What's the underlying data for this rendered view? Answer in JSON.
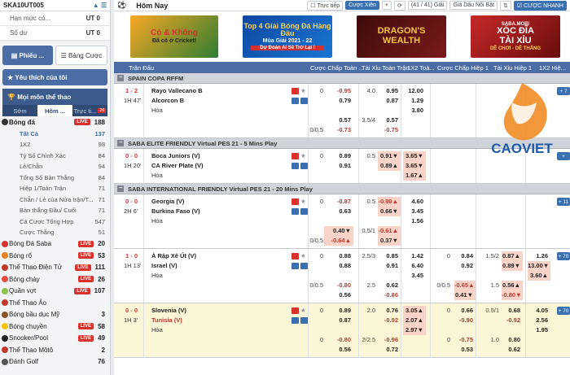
{
  "account": {
    "username": "SKA10UT005",
    "arrows": "▲ ☰",
    "rows": [
      {
        "label": "Hạn mức có...",
        "value": "UT 0"
      },
      {
        "label": "Số dư",
        "value": "UT 0"
      }
    ]
  },
  "ticket_tabs": [
    {
      "label": "Phiếu ...",
      "icon": "ticket-icon"
    },
    {
      "label": "Bảng Cược",
      "icon": "list-icon"
    }
  ],
  "favorites": "Yêu thích của tôi",
  "all_sports": "Mọi môn thể thao",
  "sub_tabs": [
    "Sớm",
    "Hôm ...",
    "Trực ti..."
  ],
  "sub_tab_badge": "26",
  "sports": [
    {
      "name": "Bóng đá",
      "live": "LIVE",
      "count": "188",
      "color": "#333"
    },
    {
      "name": "Bóng Đá Saba",
      "live": "LIVE",
      "count": "20",
      "color": "#d9322c"
    },
    {
      "name": "Bóng rổ",
      "live": "LIVE",
      "count": "53",
      "color": "#e67e22"
    },
    {
      "name": "Thể Thao Điện Tử",
      "live": "LIVE",
      "count": "111",
      "color": "#c0392b"
    },
    {
      "name": "Bóng chày",
      "live": "LIVE",
      "count": "26",
      "color": "#e74c3c"
    },
    {
      "name": "Quần vợt",
      "live": "LIVE",
      "count": "107",
      "color": "#8bc34a"
    },
    {
      "name": "Thể Thao Ảo",
      "live": "",
      "count": "",
      "color": "#c0392b"
    },
    {
      "name": "Bóng bầu dục Mỹ",
      "live": "",
      "count": "3",
      "color": "#8d5524"
    },
    {
      "name": "Bóng chuyền",
      "live": "LIVE",
      "count": "58",
      "color": "#f1c40f"
    },
    {
      "name": "Snooker/Pool",
      "live": "LIVE",
      "count": "49",
      "color": "#222"
    },
    {
      "name": "Thể Thao Môtô",
      "live": "",
      "count": "2",
      "color": "#c0392b"
    },
    {
      "name": "Đánh Golf",
      "live": "",
      "count": "76",
      "color": "#555"
    }
  ],
  "football_sub": [
    {
      "name": "Tất Cả",
      "count": "137"
    },
    {
      "name": "1X2",
      "count": "98"
    },
    {
      "name": "Tỷ Số Chính Xác",
      "count": "84"
    },
    {
      "name": "Lẻ/Chẵn",
      "count": "94"
    },
    {
      "name": "Tổng Số Bàn Thắng",
      "count": "84"
    },
    {
      "name": "Hiệp 1/Toàn Trận",
      "count": "71"
    },
    {
      "name": "Chẵn / Lẻ của Nửa trận/T...",
      "count": "71"
    },
    {
      "name": "Bàn thắng Đầu/ Cuối",
      "count": "71"
    },
    {
      "name": "Cá Cược Tổng Hợp",
      "count": "547"
    },
    {
      "name": "Cược Thắng",
      "count": "51"
    }
  ],
  "topbar": {
    "title": "Hôm Nay",
    "live_chk": "Trực tiếp",
    "bet_btn": "Cược Xiên",
    "plus": "+",
    "page": "(41 / 41) Giải",
    "odds_sel": "Giá Dấu Nổi Bật",
    "fast": "CƯỢC NHANH"
  },
  "banners": [
    {
      "line1": "Cỏ & Không",
      "line2": "Đã có ở Cricket!",
      "bg": "#2e7d32"
    },
    {
      "line1": "Top 4 Giải Bóng Đá Hàng Đầu",
      "line2": "Mùa Giải 2021 - 22",
      "line3": "Dự Đoán Ai Sẽ Trở Lại !",
      "bg": "#0d47a1"
    },
    {
      "line1": "DRAGON'S",
      "line2": "WEALTH",
      "bg": "#4a0e0e"
    },
    {
      "line1": "SABA.MOBI",
      "line2": "XÓC ĐĨA",
      "line3": "TÀI XỈU",
      "line4": "DỄ CHƠI - DỄ THẮNG",
      "bg": "#b71c1c"
    }
  ],
  "headers": {
    "time": "Trận Đấu",
    "h1": "Cược Chấp Toàn ...",
    "h2": "Tài Xỉu Toàn Trận",
    "h3": "1X2 Toà...",
    "h4": "Cược Chấp Hiệp 1",
    "h5": "Tài Xỉu Hiệp 1",
    "h6": "1X2 Hiệ..."
  },
  "leagues": [
    {
      "name": "SPAIN COPA RFFM",
      "matches": [
        {
          "score": "1 - 2",
          "time": "1H 47'",
          "home": "Rayo Vallecano B",
          "away": "Alcorcon B",
          "draw": "Hòa",
          "rows": [
            {
              "hdp": "0",
              "hdp_h": "-0.95",
              "ou": "4.0",
              "ou_h": "0.95",
              "x1": "12.00"
            },
            {
              "hdp_a": "0.79",
              "ou_a": "0.87",
              "x2": "1.29"
            },
            {
              "x3": "3.80"
            },
            {
              "hdp_h": "0.57",
              "ou": "3.5/4",
              "ou_h": "0.57"
            },
            {
              "hdp": "0/0.5",
              "hdp_a": "-0.73",
              "ou_a": "-0.75"
            }
          ]
        }
      ]
    },
    {
      "name": "SABA ELITE FRIENDLY Virtual PES 21 - 5 Mins Play",
      "matches": [
        {
          "score": "0 - 0",
          "time": "1H 20'",
          "home": "Boca Juniors (V)",
          "away": "CA River Plate (V)",
          "draw": "Hòa",
          "rows": [
            {
              "hdp": "0",
              "hdp_h": "0.89",
              "ou": "0.5",
              "ou_h": "0.91▼",
              "x1": "3.65▼"
            },
            {
              "hdp_a": "0.91",
              "ou_a": "0.89▲",
              "x2": "3.65▼"
            },
            {
              "x3": "1.67▲"
            }
          ]
        }
      ]
    },
    {
      "name": "SABA INTERNATIONAL FRIENDLY Virtual PES 21 - 20 Mins Play",
      "matches": [
        {
          "score": "0 - 0",
          "time": "2H 6'",
          "home": "Georgia (V)",
          "away": "Burkina Faso (V)",
          "draw": "Hòa",
          "yellow": false,
          "rows": [
            {
              "hdp": "0",
              "hdp_h": "-0.87",
              "ou": "0.5",
              "ou_h": "-0.90▲",
              "x1": "4.60"
            },
            {
              "hdp_a": "0.63",
              "ou_a": "0.66▼",
              "x2": "3.45"
            },
            {
              "x3": "1.56"
            },
            {
              "hdp_h": "0.40▼",
              "ou": "0.5/1",
              "ou_h": "-0.61▲"
            },
            {
              "hdp": "0/0.5",
              "hdp_a": "-0.64▲",
              "ou_a": "0.37▼"
            }
          ],
          "more": "+ 11"
        },
        {
          "score": "1 - 0",
          "time": "1H 13'",
          "home": "Ả Rập Xê Út (V)",
          "away": "Israel (V)",
          "draw": "Hòa",
          "rows": [
            {
              "hdp": "0",
              "hdp_h": "0.88",
              "ou": "2.5/3",
              "ou_h": "0.85",
              "x1": "1.42",
              "h1": "0",
              "h1_h": "0.84",
              "t1": "1.5/2",
              "t1_h": "0.87▲",
              "y1": "1.26"
            },
            {
              "hdp_a": "0.88",
              "ou_a": "0.91",
              "x2": "6.40",
              "h1_a": "0.92",
              "t1_a": "0.89▼",
              "y2": "13.00▼"
            },
            {
              "x3": "3.45",
              "y3": "3.60▲"
            },
            {
              "hdp": "0/0.5",
              "hdp_h": "-0.80",
              "ou": "2.5",
              "ou_h": "0.62",
              "h1": "0/0.5",
              "h1_h": "-0.65▲",
              "t1": "1.5",
              "t1_h": "0.56▲"
            },
            {
              "hdp_a": "0.56",
              "ou_a": "-0.86",
              "h1_a": "0.41▼",
              "t1_a": "-0.80▼"
            }
          ],
          "more": "+ 70"
        },
        {
          "score": "0 - 0",
          "time": "1H 3'",
          "home": "Slovenia (V)",
          "away": "Tunisia (V)",
          "draw": "Hòa",
          "yellow": true,
          "rows": [
            {
              "hdp": "0",
              "hdp_h": "0.89",
              "ou": "2.0",
              "ou_h": "0.76",
              "x1": "3.05▲",
              "h1": "0",
              "h1_h": "0.66",
              "t1": "0.5/1",
              "t1_h": "0.68",
              "y1": "4.05"
            },
            {
              "hdp_a": "0.87",
              "ou_a": "-0.92",
              "x2": "2.07▲",
              "h1_a": "-0.90",
              "t1_a": "-0.92",
              "y2": "2.56"
            },
            {
              "x3": "2.97▼",
              "y3": "1.95"
            },
            {
              "hdp": "0",
              "hdp_h": "-0.80",
              "ou": "2/2.5",
              "ou_h": "-0.96",
              "h1": "0",
              "h1_h": "-0.75",
              "t1": "1.0",
              "t1_h": "0.80"
            },
            {
              "hdp_a": "0.56",
              "ou_a": "0.72",
              "h1_a": "0.53",
              "t1_a": "0.62"
            }
          ],
          "more": "+ 70"
        }
      ]
    }
  ],
  "first_more": "+ 7",
  "second_more": "+",
  "logo_text": "CAOVIET"
}
